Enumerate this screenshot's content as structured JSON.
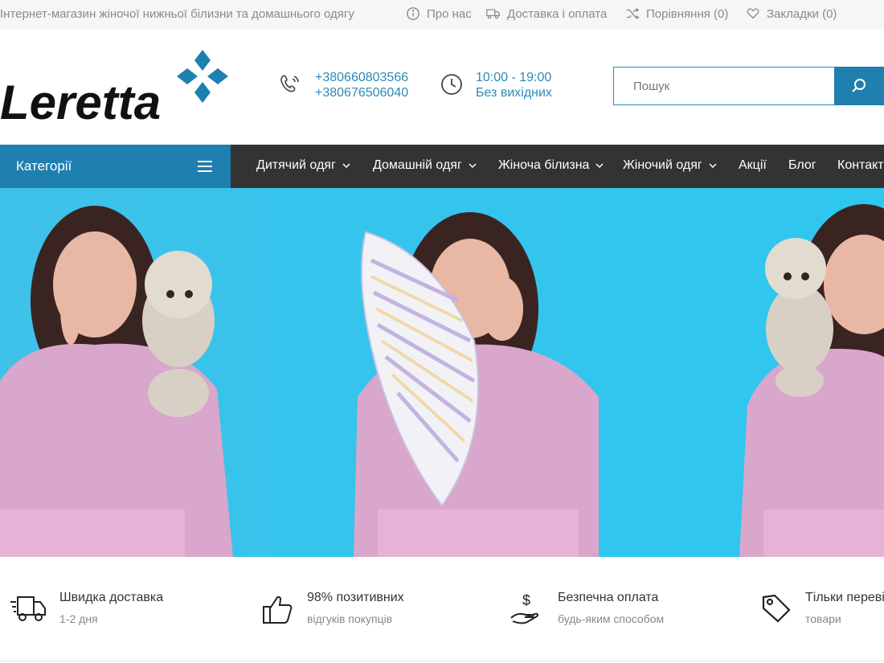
{
  "topbar": {
    "tagline": "Інтернет-магазин жіночої нижньої білизни та домашнього одягу",
    "about": "Про нас",
    "delivery": "Доставка і оплата",
    "compare": "Порівняння (0)",
    "bookmarks": "Закладки (0)",
    "icons": [
      "info-icon",
      "truck-icon",
      "shuffle-icon",
      "heart-icon"
    ]
  },
  "header": {
    "logo_text": "Leretta",
    "phone1": "+380660803566",
    "phone2": "+380676506040",
    "hours": "10:00 - 19:00",
    "days": "Без вихідних",
    "search_placeholder": "Пошук"
  },
  "nav": {
    "categories": "Категорії",
    "items": [
      "Дитячий одяг",
      "Домашній одяг",
      "Жіноча білизна",
      "Жіночий одяг",
      "Акції",
      "Блог",
      "Контакти"
    ]
  },
  "features": [
    {
      "title": "Швидка доставка",
      "sub": "1-2 дня",
      "icon": "fast-truck-icon"
    },
    {
      "title": "98% позитивних",
      "sub": "відгуків покупців",
      "icon": "thumbs-up-icon"
    },
    {
      "title": "Безпечна оплата",
      "sub": "будь-яким способом",
      "icon": "payment-hand-icon"
    },
    {
      "title": "Тільки перевірені",
      "sub": "товари",
      "icon": "price-tag-icon"
    }
  ],
  "colors": {
    "accent": "#1f7fae",
    "nav_bg": "#333333",
    "hero_bg": "#35c4ec",
    "link": "#2b8ab8",
    "sweater": "#d9a6cc"
  }
}
